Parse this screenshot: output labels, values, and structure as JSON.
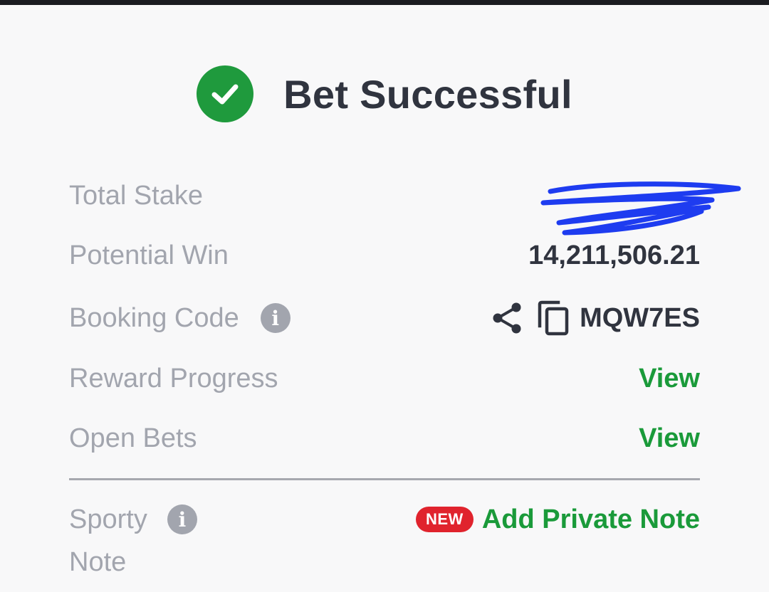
{
  "header": {
    "title": "Bet Successful",
    "status_icon": "check-circle-icon",
    "success_color": "#1f9a3d"
  },
  "rows": {
    "total_stake": {
      "label": "Total Stake",
      "value": "",
      "value_state": "redacted with scribble"
    },
    "potential_win": {
      "label": "Potential Win",
      "value": "14,211,506.21"
    },
    "booking_code": {
      "label": "Booking Code",
      "value": "MQW7ES",
      "info_icon": "info-icon",
      "share_icon": "share-icon",
      "copy_icon": "copy-icon"
    },
    "reward_progress": {
      "label": "Reward Progress",
      "action": "View"
    },
    "open_bets": {
      "label": "Open Bets",
      "action": "View"
    }
  },
  "note": {
    "label_line1": "Sporty",
    "label_line2": "Note",
    "badge": "NEW",
    "action": "Add Private Note"
  },
  "colors": {
    "accent_green": "#1a9a3a",
    "badge_red": "#e0232d",
    "label_gray": "#a2a5ae",
    "text_dark": "#30343f",
    "redaction_blue": "#1e3cf0"
  }
}
